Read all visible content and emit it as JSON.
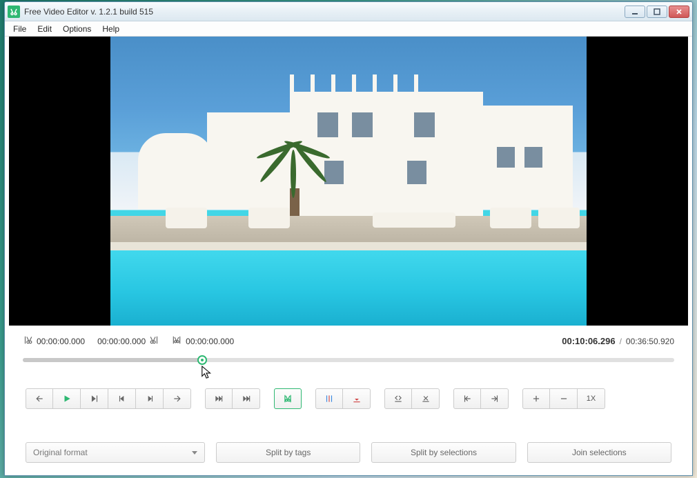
{
  "window": {
    "title": "Free Video Editor v. 1.2.1 build 515"
  },
  "menu": {
    "file": "File",
    "edit": "Edit",
    "options": "Options",
    "help": "Help"
  },
  "times": {
    "sel_start": "00:00:00.000",
    "sel_end": "00:00:00.000",
    "mark": "00:00:00.000",
    "current": "00:10:06.296",
    "separator": "/",
    "total": "00:36:50.920",
    "progress_pct": 27.5
  },
  "toolbar": {
    "zoom_label": "1X"
  },
  "bottom": {
    "format_label": "Original format",
    "split_tags": "Split by tags",
    "split_sel": "Split by selections",
    "join_sel": "Join selections"
  }
}
